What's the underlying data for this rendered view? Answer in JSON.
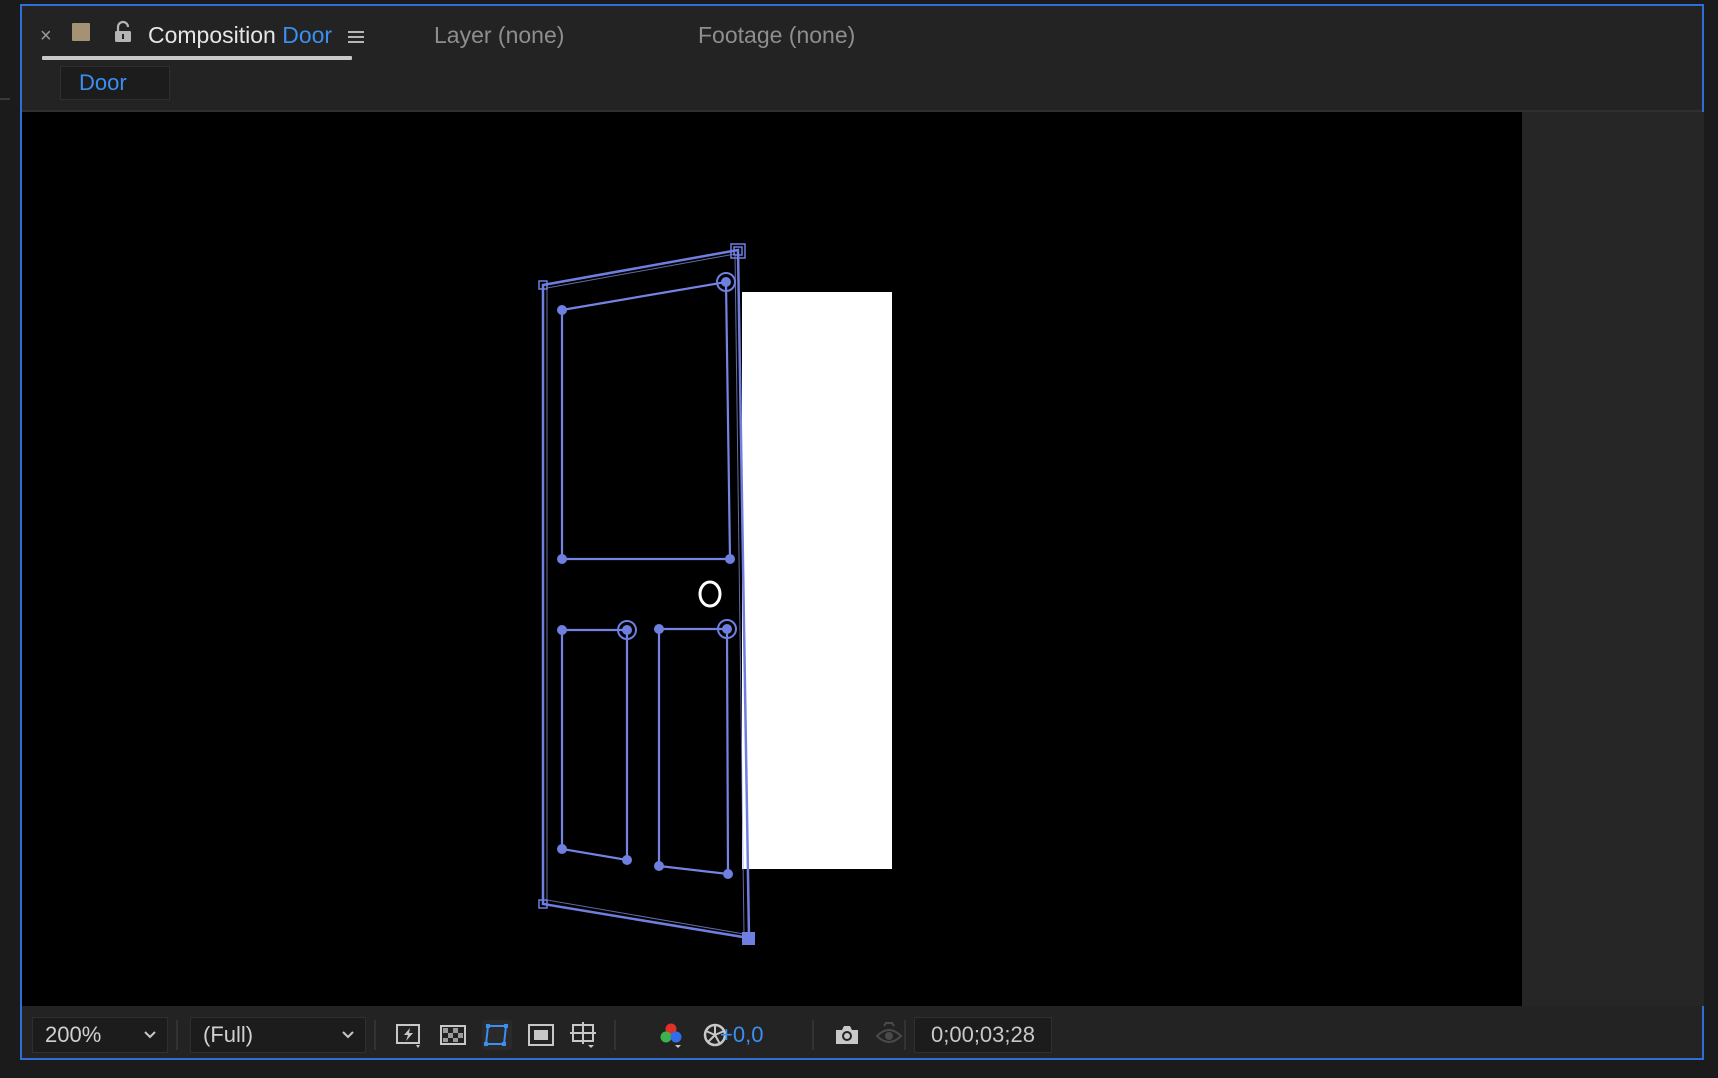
{
  "tabs": {
    "close_glyph": "×",
    "composition_label": "Composition",
    "composition_name": "Door",
    "layer_tab": "Layer (none)",
    "footage_tab": "Footage (none)",
    "swatch_color": "#a59174",
    "accent_color": "#3a8ff0"
  },
  "comp_sub_tab": {
    "label": "Door"
  },
  "viewer": {
    "background": "#000000",
    "selection_color": "#6f7fe0",
    "layer": "door shape (selected, with path outlines)"
  },
  "toolbar": {
    "zoom_value": "200%",
    "resolution_value": "(Full)",
    "exposure_value": "+0,0",
    "timecode": "0;00;03;28",
    "icons": [
      "fast-previews-icon",
      "transparency-grid-icon",
      "mask-path-visibility-icon",
      "region-of-interest-icon",
      "grid-guides-icon",
      "show-channel-icon",
      "reset-exposure-icon",
      "snapshot-icon",
      "show-snapshot-icon"
    ]
  }
}
